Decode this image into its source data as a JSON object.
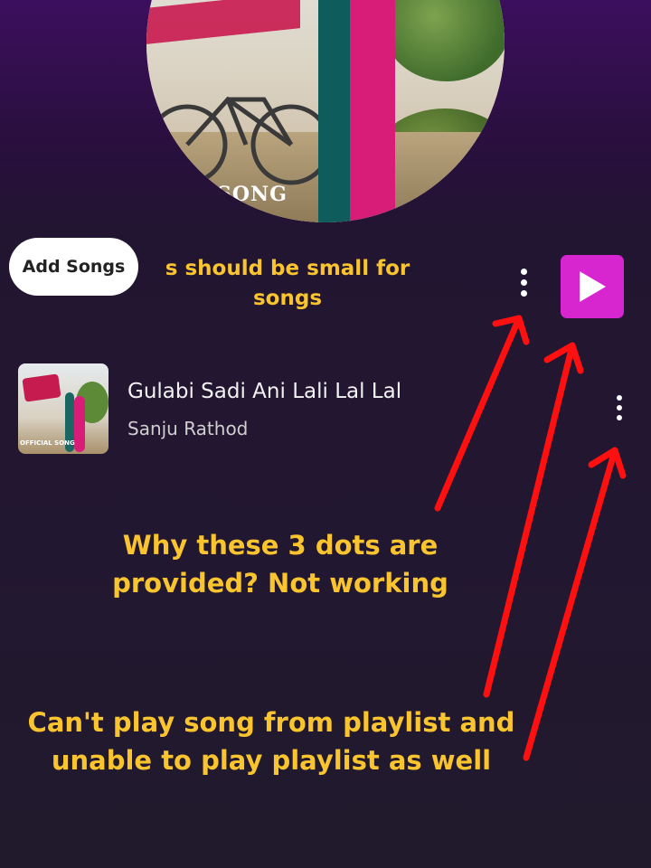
{
  "playlist": {
    "cover_label": "SONG",
    "add_songs_label": "Add Songs",
    "menu_icon": "more-vertical-icon",
    "play_icon": "play-icon",
    "accent_color": "#d726cf"
  },
  "songs": [
    {
      "title": "Gulabi Sadi Ani Lali Lal Lal",
      "artist": "Sanju Rathod",
      "thumb_label": "OFFICIAL SONG"
    }
  ],
  "annotations": {
    "note_small_for_songs": "s should be small for songs",
    "note_three_dots": "Why these 3 dots are provided? Not working",
    "note_cant_play": "Can't play song from playlist and unable to play playlist as well",
    "note_color": "#f9c42d",
    "arrow_color": "#ff1010"
  }
}
